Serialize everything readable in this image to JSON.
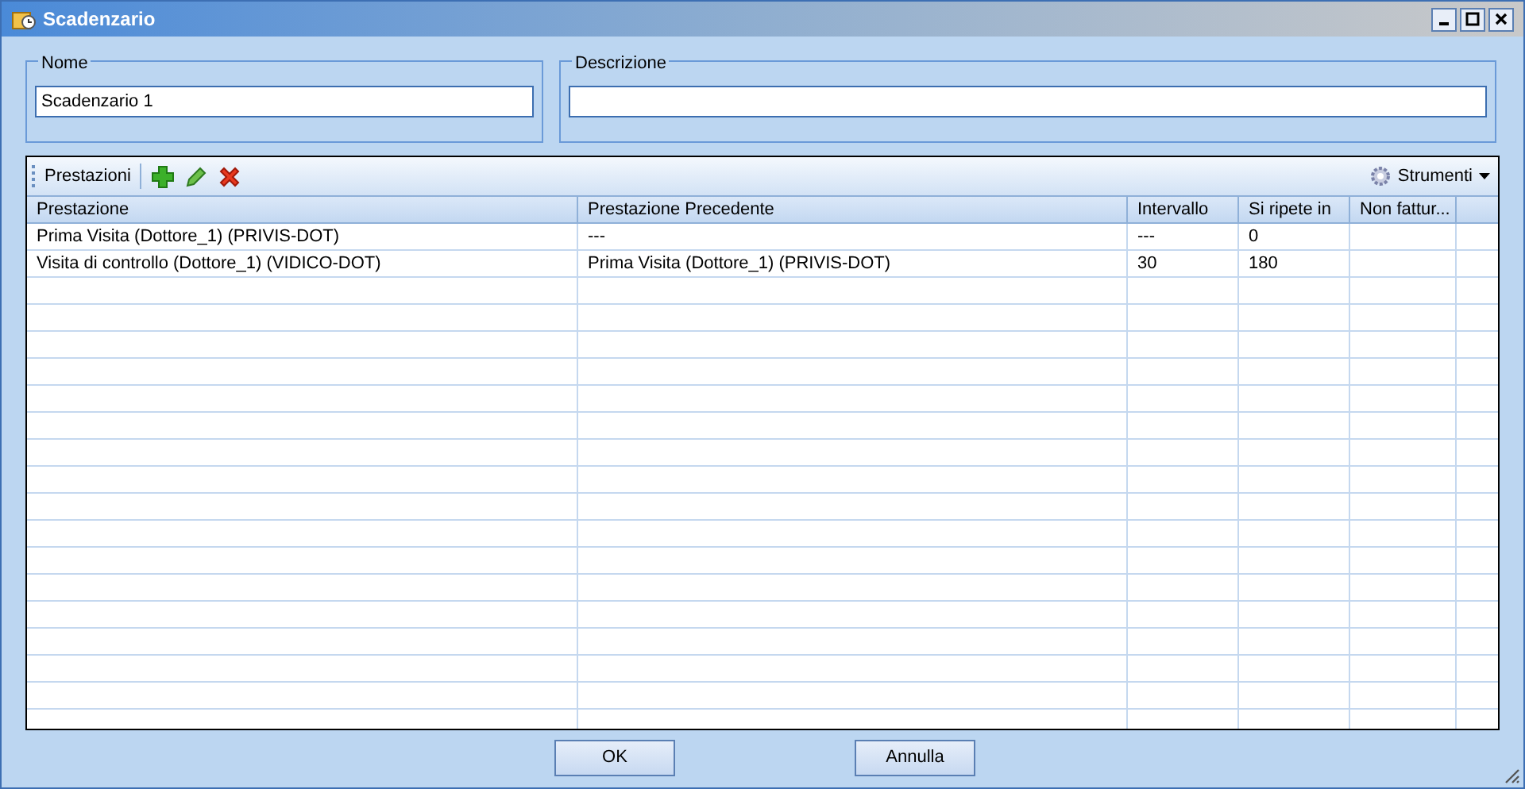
{
  "window": {
    "title": "Scadenzario"
  },
  "nome": {
    "label": "Nome",
    "value": "Scadenzario 1"
  },
  "descrizione": {
    "label": "Descrizione"
  },
  "toolbar": {
    "label": "Prestazioni",
    "tools": "Strumenti"
  },
  "table": {
    "columns": [
      "Prestazione",
      "Prestazione Precedente",
      "Intervallo",
      "Si ripete in",
      "Non fattur..."
    ],
    "rows": [
      [
        "Prima Visita (Dottore_1) (PRIVIS-DOT)",
        "---",
        "---",
        "0",
        ""
      ],
      [
        "Visita di controllo (Dottore_1) (VIDICO-DOT)",
        "Prima Visita (Dottore_1) (PRIVIS-DOT)",
        "30",
        "180",
        ""
      ]
    ]
  },
  "buttons": [
    "OK",
    "Annulla"
  ]
}
